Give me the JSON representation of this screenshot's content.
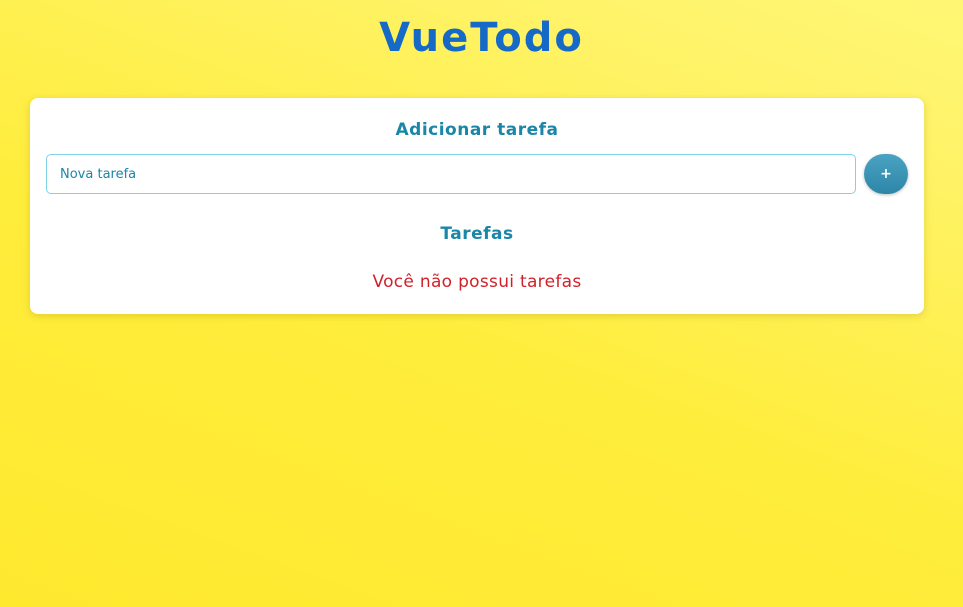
{
  "app": {
    "title": "VueTodo"
  },
  "add_section": {
    "title": "Adicionar tarefa",
    "input_placeholder": "Nova tarefa",
    "input_value": "",
    "add_button_label": "+"
  },
  "tasks_section": {
    "title": "Tarefas",
    "empty_message": "Você não possui tarefas",
    "items": []
  },
  "colors": {
    "background": "#ffed3c",
    "title": "#1569c7",
    "accent": "#1a86a8",
    "button": "#3a96b8",
    "empty_message": "#d1202a",
    "card": "#ffffff"
  }
}
